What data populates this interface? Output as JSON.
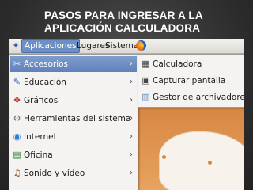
{
  "slide": {
    "title_line1": "PASOS PARA INGRESAR A LA",
    "title_line2": "APLICACIÓN CALCULADORA"
  },
  "panel": {
    "items": [
      {
        "label": "Aplicaciones",
        "active": true
      },
      {
        "label": "Lugares"
      },
      {
        "label": "Sistema"
      }
    ],
    "launcher_icon": "firefox-icon"
  },
  "applications_menu": [
    {
      "label": "Accesorios",
      "icon": "accessories-icon",
      "highlighted": true,
      "submenu": true
    },
    {
      "label": "Educación",
      "icon": "education-icon",
      "submenu": true
    },
    {
      "label": "Gráficos",
      "icon": "graphics-icon",
      "submenu": true
    },
    {
      "label": "Herramientas del sistema",
      "icon": "system-tools-icon",
      "submenu": true
    },
    {
      "label": "Internet",
      "icon": "internet-icon",
      "submenu": true
    },
    {
      "label": "Oficina",
      "icon": "office-icon",
      "submenu": true
    },
    {
      "label": "Sonido y vídeo",
      "icon": "sound-video-icon",
      "submenu": true
    }
  ],
  "accessories_submenu": [
    {
      "label": "Calculadora",
      "icon": "calculator-icon"
    },
    {
      "label": "Capturar pantalla",
      "icon": "screenshot-icon"
    },
    {
      "label": "Gestor de archivadores",
      "icon": "archive-manager-icon"
    }
  ],
  "arrow_glyph": "›",
  "colors": {
    "highlight": "#6c8fc4",
    "desktop": "#d88a45",
    "slide_background": "#2b2b2b"
  }
}
